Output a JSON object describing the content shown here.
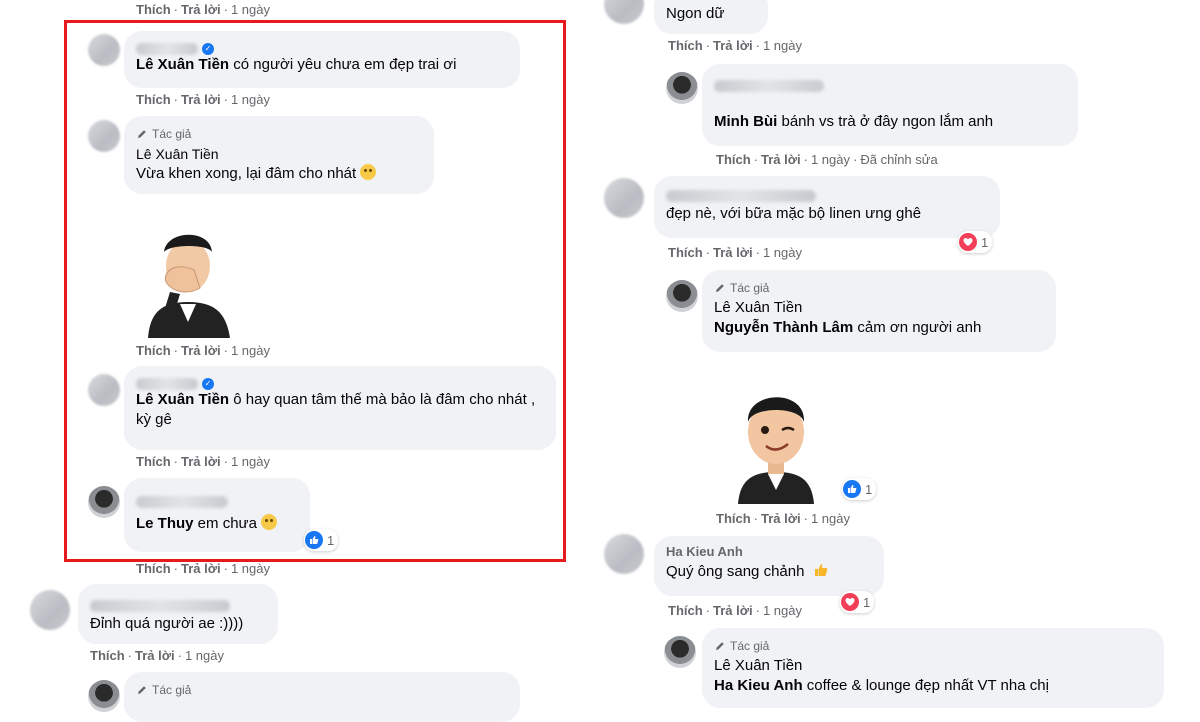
{
  "ui": {
    "like": "Thích",
    "reply": "Trả lời",
    "time": "1 ngày",
    "edited": "Đã chỉnh sửa",
    "author_label": "Tác giả",
    "accent": "#1877f2",
    "highlight_color": "#e8191d"
  },
  "left_column": {
    "c1": {
      "mention": "Lê Xuân Tiền",
      "text": " có người yêu chưa em đẹp trai ơi"
    },
    "c2": {
      "author": "Lê Xuân Tiền",
      "text": "Vừa khen xong, lại đâm cho nhát",
      "emoji": "relieved-face-emoji"
    },
    "c3": {
      "sticker": "facepalm-avatar-sticker"
    },
    "c4": {
      "mention": "Lê Xuân Tiền",
      "text": " ô hay quan tâm thế mà bảo là đâm cho nhát , kỳ gê"
    },
    "c5": {
      "mention": "Le Thuy",
      "text": " em chưa",
      "emoji": "flushed-face-emoji",
      "reaction_count": "1"
    },
    "c6": {
      "text": "Đỉnh quá người ae :))))"
    },
    "c7": {
      "author_label": "Tác giả"
    }
  },
  "right_column": {
    "r1": {
      "text": "Ngon dữ"
    },
    "r2": {
      "mention": "Minh Bùi",
      "text": " bánh vs trà ở đây ngon lắm anh"
    },
    "r3": {
      "text": "đẹp nè, với bữa mặc bộ linen ưng ghê",
      "reaction_count": "1"
    },
    "r4": {
      "author": "Lê Xuân Tiền",
      "mention": "Nguyễn Thành Lâm",
      "text": " cảm ơn người anh"
    },
    "r5": {
      "sticker": "wink-avatar-sticker",
      "reaction_count": "1"
    },
    "r6": {
      "name": "Ha Kieu Anh",
      "text": "Quý ông sang chảnh",
      "reaction_count": "1"
    },
    "r7": {
      "author": "Lê Xuân Tiền",
      "mention": "Ha Kieu Anh",
      "text": " coffee & lounge đẹp nhất VT nha chị"
    }
  }
}
